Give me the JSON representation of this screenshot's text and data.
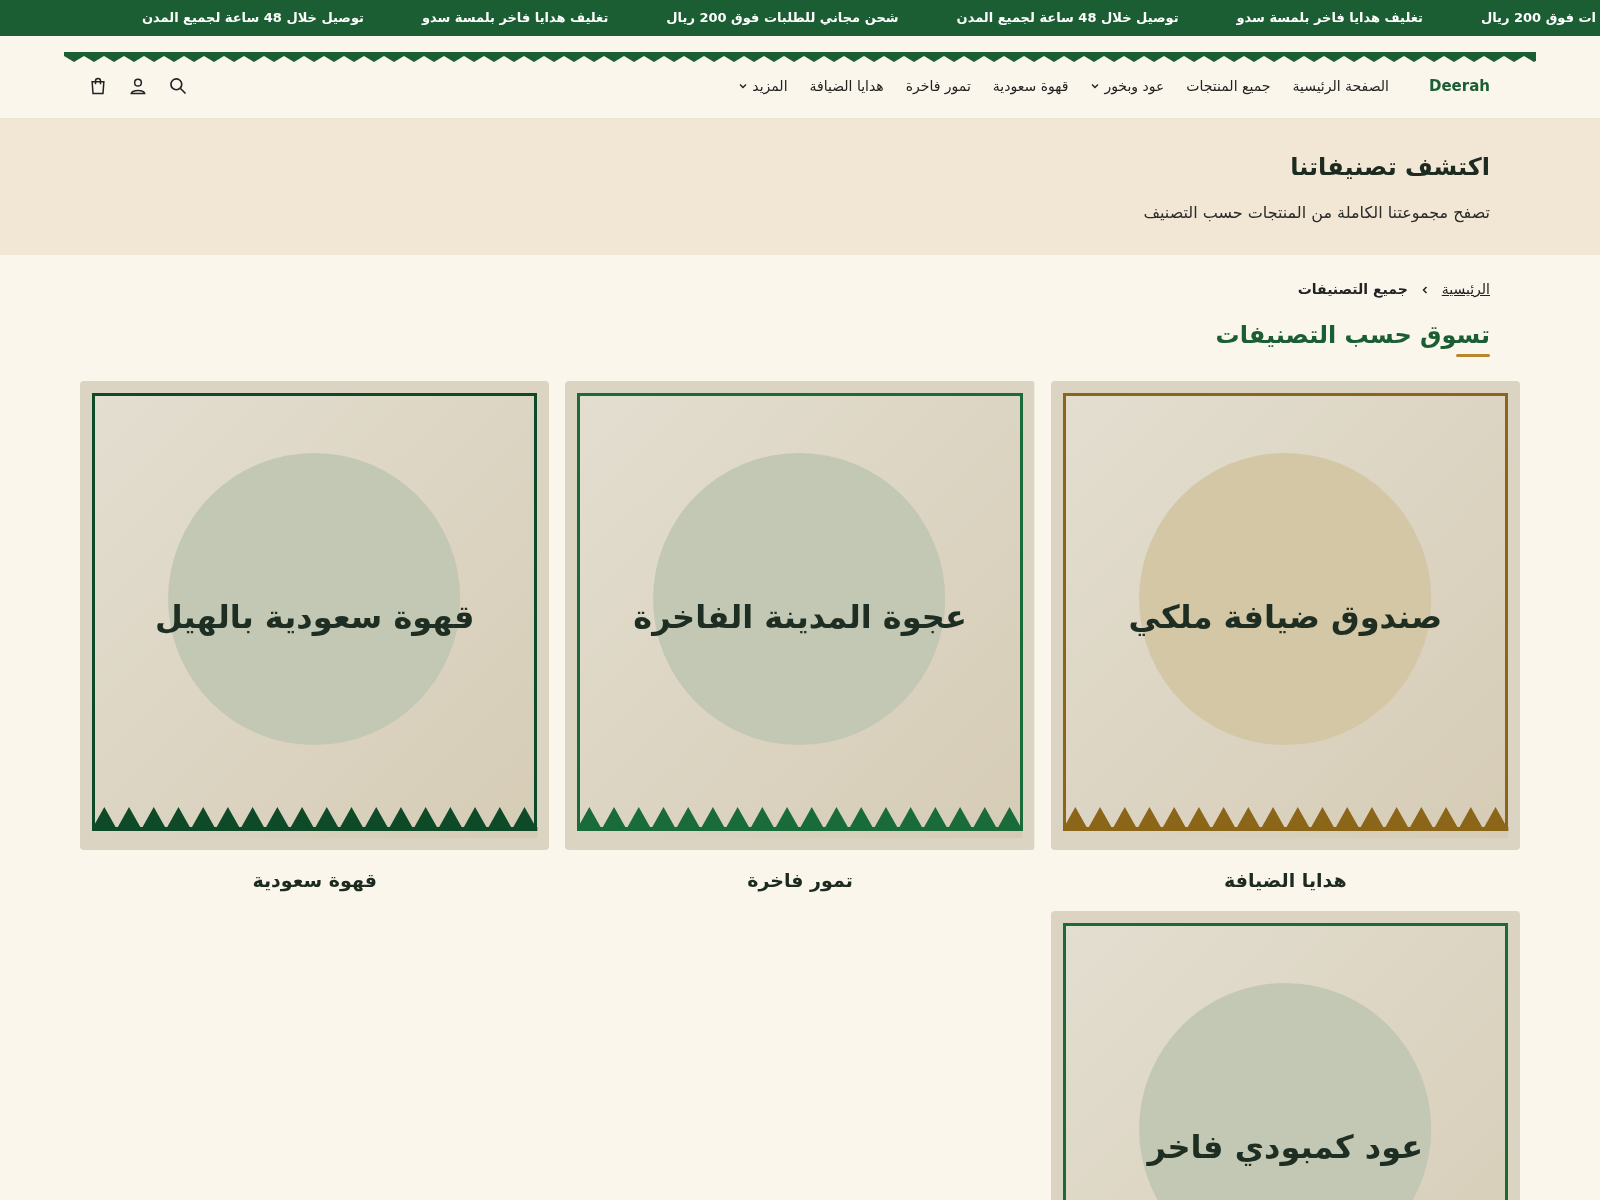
{
  "announcement_bar": {
    "items": [
      "ات فوق 200 ريال",
      "تغليف هدايا فاخر بلمسة سدو",
      "توصيل خلال 48 ساعة لجميع المدن",
      "شحن مجاني للطلبات فوق 200 ريال",
      "تغليف هدايا فاخر بلمسة سدو",
      "توصيل خلال 48 ساعة لجميع المدن"
    ]
  },
  "header": {
    "logo": "Deerah",
    "nav": [
      {
        "label": "الصفحة الرئيسية",
        "has_dropdown": false
      },
      {
        "label": "جميع المنتجات",
        "has_dropdown": false
      },
      {
        "label": "عود وبخور",
        "has_dropdown": true
      },
      {
        "label": "قهوة سعودية",
        "has_dropdown": false
      },
      {
        "label": "تمور فاخرة",
        "has_dropdown": false
      },
      {
        "label": "هدايا الضيافة",
        "has_dropdown": false
      },
      {
        "label": "المزيد",
        "has_dropdown": true
      }
    ]
  },
  "hero": {
    "title": "اكتشف تصنيفاتنا",
    "subtitle": "تصفح مجموعتنا الكاملة من المنتجات حسب التصنيف"
  },
  "breadcrumb": [
    {
      "label": "الرئيسية",
      "kind": "link"
    },
    {
      "label": "جميع التصنيفات",
      "kind": "current"
    }
  ],
  "section_title": "تسوق حسب التصنيفات",
  "categories": [
    {
      "name": "هدايا الضيافة",
      "image_label": "صندوق ضيافة ملكي",
      "color": "#8b6518"
    },
    {
      "name": "تمور فاخرة",
      "image_label": "عجوة المدينة الفاخرة",
      "color": "#1a6b3a"
    },
    {
      "name": "قهوة سعودية",
      "image_label": "قهوة سعودية بالهيل",
      "color": "#0f4a28"
    },
    {
      "image_label": "عود كمبودي فاخر",
      "color": "#1a6b3a"
    }
  ]
}
